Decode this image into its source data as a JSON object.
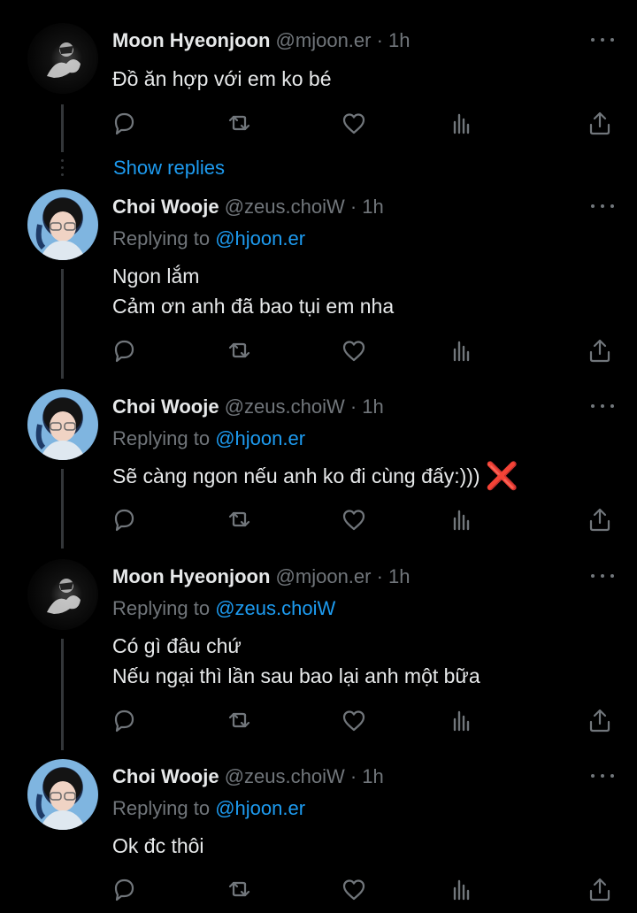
{
  "thread": [
    {
      "name": "Moon Hyeonjoon",
      "meta": "@mjoon.er · 1h",
      "replying_prefix": "",
      "replying_to": "",
      "lines": [
        "Đồ ăn hợp với em ko bé"
      ],
      "avatar": "moon-avatar"
    },
    {
      "name": "Choi Wooje",
      "meta": "@zeus.choiW · 1h",
      "replying_prefix": "Replying to ",
      "replying_to": "@hjoon.er",
      "lines": [
        "Ngon lắm",
        "Cảm ơn anh đã bao tụi em nha"
      ],
      "avatar": "choi-avatar"
    },
    {
      "name": "Choi Wooje",
      "meta": "@zeus.choiW · 1h",
      "replying_prefix": "Replying to ",
      "replying_to": "@hjoon.er",
      "lines": [
        "Sẽ càng ngon nếu anh ko đi cùng đấy:)))"
      ],
      "emoji": "❌",
      "avatar": "choi-avatar"
    },
    {
      "name": "Moon Hyeonjoon",
      "meta": "@mjoon.er · 1h",
      "replying_prefix": "Replying to ",
      "replying_to": "@zeus.choiW",
      "lines": [
        "Có gì đâu chứ",
        "Nếu ngại thì lần sau bao lại anh một bữa"
      ],
      "avatar": "moon-avatar"
    },
    {
      "name": "Choi Wooje",
      "meta": "@zeus.choiW · 1h",
      "replying_prefix": "Replying to ",
      "replying_to": "@hjoon.er",
      "lines": [
        "Ok đc thôi"
      ],
      "avatar": "choi-avatar"
    }
  ],
  "show_replies_label": "Show replies",
  "action_icons": [
    "reply-icon",
    "retweet-icon",
    "like-icon",
    "views-icon",
    "share-icon"
  ],
  "colors": {
    "background": "#000000",
    "text": "#e7e9ea",
    "muted": "#71767b",
    "link": "#1d9bf0",
    "line": "#333639"
  }
}
